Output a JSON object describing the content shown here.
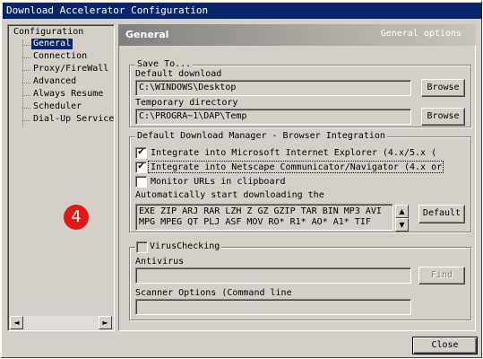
{
  "window": {
    "title": "Download Accelerator Configuration"
  },
  "tree": {
    "root": "Configuration",
    "items": [
      {
        "label": "General",
        "selected": true
      },
      {
        "label": "Connection"
      },
      {
        "label": "Proxy/FireWall"
      },
      {
        "label": "Advanced"
      },
      {
        "label": "Always Resume"
      },
      {
        "label": "Scheduler"
      },
      {
        "label": "Dial-Up Service"
      }
    ],
    "badge": "4",
    "scroll_left": "◄",
    "scroll_right": "►"
  },
  "header": {
    "title": "General",
    "subtitle": "General options"
  },
  "save_to": {
    "title": "Save To...",
    "default_label": "Default download",
    "default_value": "C:\\WINDOWS\\Desktop",
    "temp_label": "Temporary directory",
    "temp_value": "C:\\PROGRA~1\\DAP\\Temp",
    "browse": "Browse"
  },
  "integration": {
    "title": "Default Download Manager - Browser Integration",
    "ie_label": "Integrate into Microsoft Internet Explorer (4.x/5.x (",
    "ie_checked": "✔",
    "ns_label": "Integrate into Netscape Communicator/Navigator (4.x or",
    "ns_checked": "✔",
    "monitor_label": "Monitor URLs in clipboard",
    "auto_label": "Automatically start downloading the",
    "extensions": "EXE ZIP ARJ RAR LZH Z GZ GZIP TAR BIN MP3 AVI\nMPG MPEG QT PLJ ASF MOV RO* R1* AO* A1* TIF",
    "scroll_up": "▲",
    "scroll_down": "▼",
    "default_button": "Default"
  },
  "virus": {
    "title": "VirusChecking",
    "antivirus_label": "Antivirus",
    "antivirus_value": "",
    "find_button": "Find",
    "scanner_label": "Scanner Options (Command line",
    "scanner_value": ""
  },
  "footer": {
    "close": "Close"
  }
}
